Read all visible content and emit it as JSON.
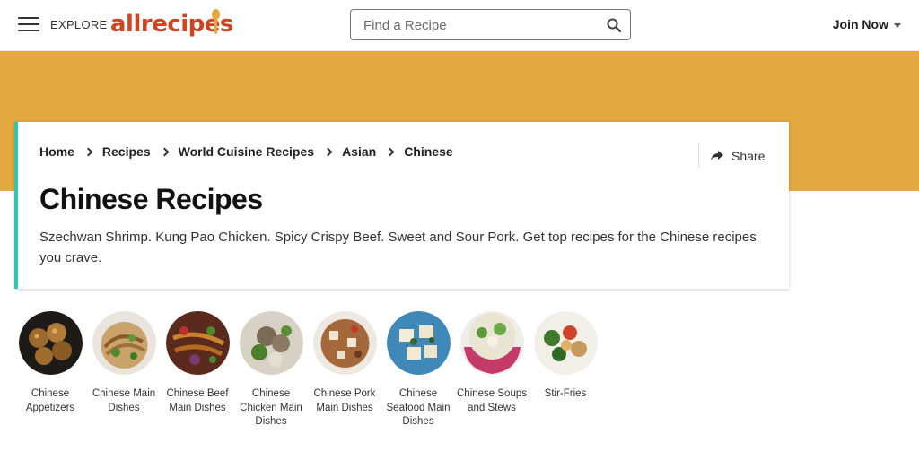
{
  "header": {
    "explore_label": "EXPLORE",
    "logo_text": "allrecipes",
    "search_placeholder": "Find a Recipe",
    "join_label": "Join Now"
  },
  "card": {
    "breadcrumbs": [
      "Home",
      "Recipes",
      "World Cuisine Recipes",
      "Asian",
      "Chinese"
    ],
    "share_label": "Share",
    "title": "Chinese Recipes",
    "description": "Szechwan Shrimp. Kung Pao Chicken. Spicy Crispy Beef. Sweet and Sour Pork. Get top recipes for the Chinese recipes you crave."
  },
  "categories": [
    {
      "label": "Chinese Appetizers"
    },
    {
      "label": "Chinese Main Dishes"
    },
    {
      "label": "Chinese Beef Main Dishes"
    },
    {
      "label": "Chinese Chicken Main Dishes"
    },
    {
      "label": "Chinese Pork Main Dishes"
    },
    {
      "label": "Chinese Seafood Main Dishes"
    },
    {
      "label": "Chinese Soups and Stews"
    },
    {
      "label": "Stir-Fries"
    }
  ],
  "colors": {
    "brand": "#ce4620",
    "banner": "#e3a83f",
    "accent": "#2fc4b2"
  },
  "icons": {
    "menu": "hamburger-icon",
    "search": "search-icon",
    "share": "share-arrow-icon",
    "dropdown": "caret-down-icon",
    "breadcrumb_separator": "chevron-right-icon"
  }
}
